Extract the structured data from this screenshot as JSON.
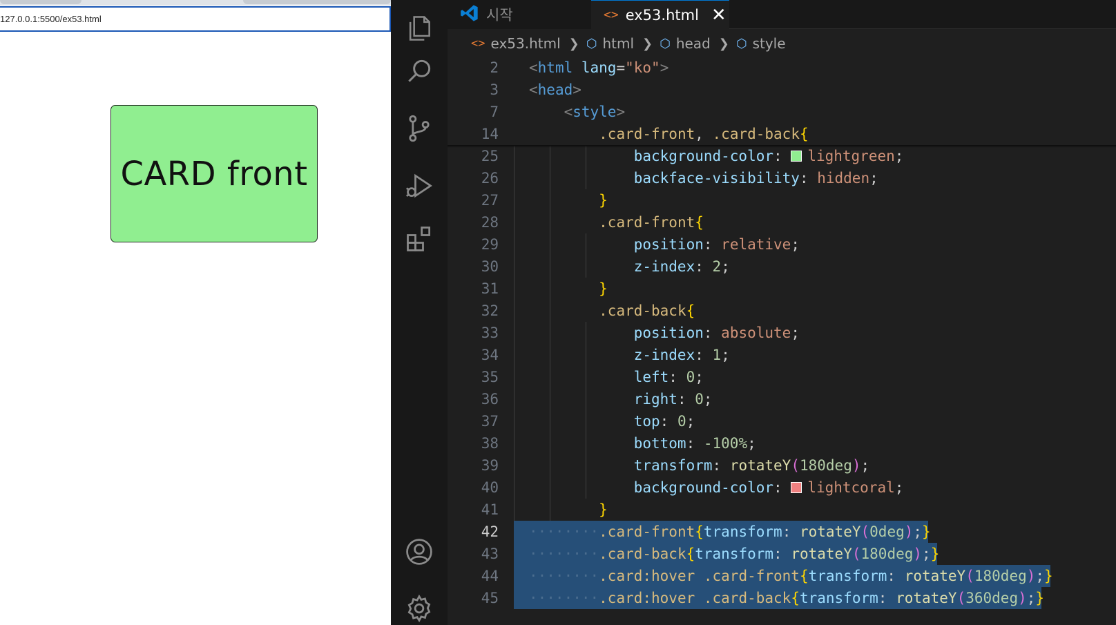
{
  "browser": {
    "url": "127.0.0.1:5500/ex53.html",
    "card_text": "CARD front",
    "card_color": "#90ee90"
  },
  "activity_bar": {
    "items": [
      "explorer-icon",
      "search-icon",
      "source-control-icon",
      "run-debug-icon",
      "extensions-icon",
      "account-icon",
      "settings-gear-icon"
    ]
  },
  "tabs": [
    {
      "label": "시작",
      "icon": "vscode-logo-icon",
      "active": false
    },
    {
      "label": "ex53.html",
      "icon": "html-file-icon",
      "active": true
    }
  ],
  "breadcrumb": [
    "ex53.html",
    "html",
    "head",
    "style"
  ],
  "editor": {
    "lines": [
      {
        "n": "2",
        "sticky": true,
        "tokens": [
          [
            "t-brk",
            "<"
          ],
          [
            "t-tag",
            "html "
          ],
          [
            "t-attr",
            "lang"
          ],
          [
            "t-pun",
            "="
          ],
          [
            "t-str",
            "\"ko\""
          ],
          [
            "t-brk",
            ">"
          ]
        ]
      },
      {
        "n": "3",
        "sticky": true,
        "tokens": [
          [
            "t-brk",
            "<"
          ],
          [
            "t-tag",
            "head"
          ],
          [
            "t-brk",
            ">"
          ]
        ]
      },
      {
        "n": "7",
        "sticky": true,
        "tokens": [
          [
            "t-pun",
            "    "
          ],
          [
            "t-brk",
            "<"
          ],
          [
            "t-tag",
            "style"
          ],
          [
            "t-brk",
            ">"
          ]
        ]
      },
      {
        "n": "14",
        "sticky": true,
        "tokens": [
          [
            "t-pun",
            "        "
          ],
          [
            "t-sel",
            ".card-front"
          ],
          [
            "t-pun",
            ", "
          ],
          [
            "t-sel",
            ".card-back"
          ],
          [
            "t-br1",
            "{"
          ]
        ]
      },
      {
        "n": "25",
        "tokens": [
          [
            "t-pun",
            "            "
          ],
          [
            "t-prop",
            "background-color"
          ],
          [
            "t-pun",
            ": "
          ],
          [
            "swatch",
            "#90ee90"
          ],
          [
            "t-val",
            "lightgreen"
          ],
          [
            "t-pun",
            ";"
          ]
        ]
      },
      {
        "n": "26",
        "tokens": [
          [
            "t-pun",
            "            "
          ],
          [
            "t-prop",
            "backface-visibility"
          ],
          [
            "t-pun",
            ": "
          ],
          [
            "t-val",
            "hidden"
          ],
          [
            "t-pun",
            ";"
          ]
        ]
      },
      {
        "n": "27",
        "tokens": [
          [
            "t-pun",
            "        "
          ],
          [
            "t-br1",
            "}"
          ]
        ]
      },
      {
        "n": "28",
        "tokens": [
          [
            "t-pun",
            "        "
          ],
          [
            "t-sel",
            ".card-front"
          ],
          [
            "t-br1",
            "{"
          ]
        ]
      },
      {
        "n": "29",
        "tokens": [
          [
            "t-pun",
            "            "
          ],
          [
            "t-prop",
            "position"
          ],
          [
            "t-pun",
            ": "
          ],
          [
            "t-val",
            "relative"
          ],
          [
            "t-pun",
            ";"
          ]
        ]
      },
      {
        "n": "30",
        "tokens": [
          [
            "t-pun",
            "            "
          ],
          [
            "t-prop",
            "z-index"
          ],
          [
            "t-pun",
            ": "
          ],
          [
            "t-num",
            "2"
          ],
          [
            "t-pun",
            ";"
          ]
        ]
      },
      {
        "n": "31",
        "tokens": [
          [
            "t-pun",
            "        "
          ],
          [
            "t-br1",
            "}"
          ]
        ]
      },
      {
        "n": "32",
        "tokens": [
          [
            "t-pun",
            "        "
          ],
          [
            "t-sel",
            ".card-back"
          ],
          [
            "t-br1",
            "{"
          ]
        ]
      },
      {
        "n": "33",
        "tokens": [
          [
            "t-pun",
            "            "
          ],
          [
            "t-prop",
            "position"
          ],
          [
            "t-pun",
            ": "
          ],
          [
            "t-val",
            "absolute"
          ],
          [
            "t-pun",
            ";"
          ]
        ]
      },
      {
        "n": "34",
        "tokens": [
          [
            "t-pun",
            "            "
          ],
          [
            "t-prop",
            "z-index"
          ],
          [
            "t-pun",
            ": "
          ],
          [
            "t-num",
            "1"
          ],
          [
            "t-pun",
            ";"
          ]
        ]
      },
      {
        "n": "35",
        "tokens": [
          [
            "t-pun",
            "            "
          ],
          [
            "t-prop",
            "left"
          ],
          [
            "t-pun",
            ": "
          ],
          [
            "t-num",
            "0"
          ],
          [
            "t-pun",
            ";"
          ]
        ]
      },
      {
        "n": "36",
        "tokens": [
          [
            "t-pun",
            "            "
          ],
          [
            "t-prop",
            "right"
          ],
          [
            "t-pun",
            ": "
          ],
          [
            "t-num",
            "0"
          ],
          [
            "t-pun",
            ";"
          ]
        ]
      },
      {
        "n": "37",
        "tokens": [
          [
            "t-pun",
            "            "
          ],
          [
            "t-prop",
            "top"
          ],
          [
            "t-pun",
            ": "
          ],
          [
            "t-num",
            "0"
          ],
          [
            "t-pun",
            ";"
          ]
        ]
      },
      {
        "n": "38",
        "tokens": [
          [
            "t-pun",
            "            "
          ],
          [
            "t-prop",
            "bottom"
          ],
          [
            "t-pun",
            ": "
          ],
          [
            "t-num",
            "-100%"
          ],
          [
            "t-pun",
            ";"
          ]
        ]
      },
      {
        "n": "39",
        "tokens": [
          [
            "t-pun",
            "            "
          ],
          [
            "t-prop",
            "transform"
          ],
          [
            "t-pun",
            ": "
          ],
          [
            "t-fn",
            "rotateY"
          ],
          [
            "t-br2",
            "("
          ],
          [
            "t-num",
            "180deg"
          ],
          [
            "t-br2",
            ")"
          ],
          [
            "t-pun",
            ";"
          ]
        ]
      },
      {
        "n": "40",
        "tokens": [
          [
            "t-pun",
            "            "
          ],
          [
            "t-prop",
            "background-color"
          ],
          [
            "t-pun",
            ": "
          ],
          [
            "swatch",
            "#f08080"
          ],
          [
            "t-val",
            "lightcoral"
          ],
          [
            "t-pun",
            ";"
          ]
        ]
      },
      {
        "n": "41",
        "tokens": [
          [
            "t-pun",
            "        "
          ],
          [
            "t-br1",
            "}"
          ]
        ]
      },
      {
        "n": "42",
        "current": true,
        "selected": true,
        "tokens": [
          [
            "t-ws",
            "········"
          ],
          [
            "t-sel",
            ".card-front"
          ],
          [
            "t-br1",
            "{"
          ],
          [
            "t-prop",
            "transform"
          ],
          [
            "t-pun",
            ": "
          ],
          [
            "t-fn",
            "rotateY"
          ],
          [
            "t-br2",
            "("
          ],
          [
            "t-num",
            "0deg"
          ],
          [
            "t-br2",
            ")"
          ],
          [
            "t-pun",
            ";"
          ],
          [
            "t-br1",
            "}"
          ],
          [
            "t-pun",
            " "
          ]
        ]
      },
      {
        "n": "43",
        "selected": true,
        "tokens": [
          [
            "t-ws",
            "········"
          ],
          [
            "t-sel",
            ".card-back"
          ],
          [
            "t-br1",
            "{"
          ],
          [
            "t-prop",
            "transform"
          ],
          [
            "t-pun",
            ": "
          ],
          [
            "t-fn",
            "rotateY"
          ],
          [
            "t-br2",
            "("
          ],
          [
            "t-num",
            "180deg"
          ],
          [
            "t-br2",
            ")"
          ],
          [
            "t-pun",
            ";"
          ],
          [
            "t-br1",
            "}"
          ],
          [
            "t-pun",
            " "
          ]
        ]
      },
      {
        "n": "44",
        "selected": true,
        "tokens": [
          [
            "t-ws",
            "········"
          ],
          [
            "t-sel",
            ".card:hover .card-front"
          ],
          [
            "t-br1",
            "{"
          ],
          [
            "t-prop",
            "transform"
          ],
          [
            "t-pun",
            ": "
          ],
          [
            "t-fn",
            "rotateY"
          ],
          [
            "t-br2",
            "("
          ],
          [
            "t-num",
            "180deg"
          ],
          [
            "t-br2",
            ")"
          ],
          [
            "t-pun",
            ";"
          ],
          [
            "t-br1",
            "}"
          ],
          [
            "t-pun",
            " "
          ]
        ]
      },
      {
        "n": "45",
        "selected": true,
        "tokens": [
          [
            "t-ws",
            "········"
          ],
          [
            "t-sel",
            ".card:hover .card-back"
          ],
          [
            "t-br1",
            "{"
          ],
          [
            "t-prop",
            "transform"
          ],
          [
            "t-pun",
            ": "
          ],
          [
            "t-fn",
            "rotateY"
          ],
          [
            "t-br2",
            "("
          ],
          [
            "t-num",
            "360deg"
          ],
          [
            "t-br2",
            ")"
          ],
          [
            "t-pun",
            ";"
          ],
          [
            "t-br1",
            "}"
          ],
          [
            "t-pun",
            " "
          ]
        ]
      }
    ]
  }
}
